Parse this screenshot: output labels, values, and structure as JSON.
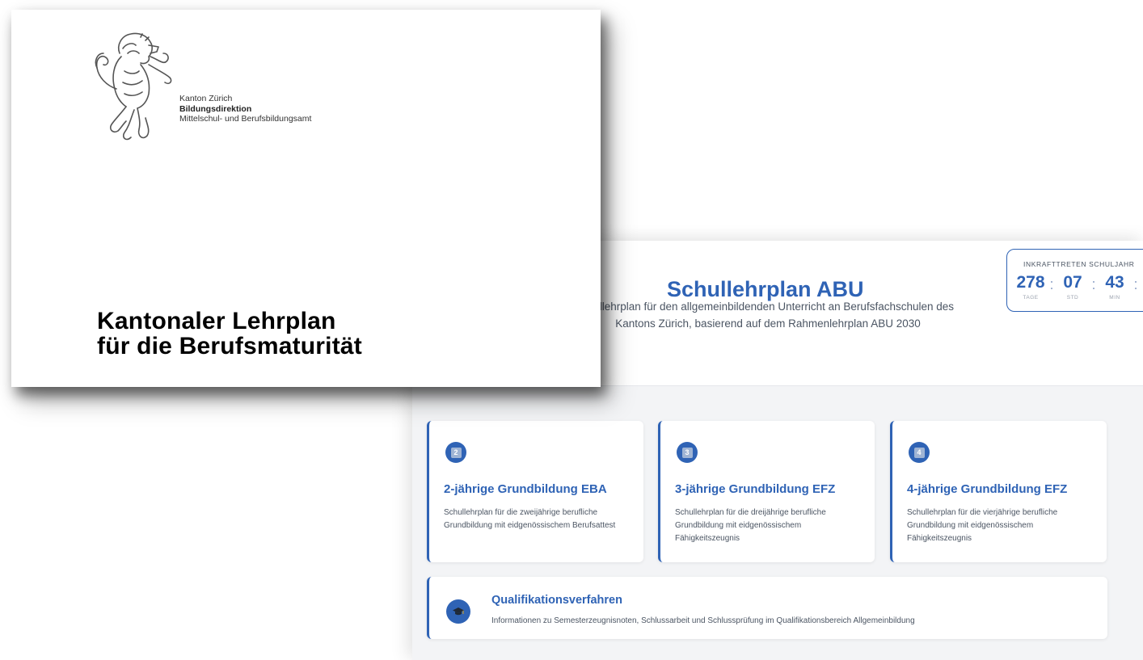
{
  "document": {
    "org_lines": [
      "Kanton Zürich",
      "Bildungsdirektion",
      "Mittelschul- und Berufsbildungsamt"
    ],
    "title_lines": [
      "Kantonaler Lehrplan",
      "für die Berufsmaturität"
    ],
    "logo": "zurich-lion-logo"
  },
  "webpage": {
    "title": "Schullehrplan ABU",
    "subtitle_lines": [
      "chullehrplan für den allgemeinbildenden Unterricht an Berufsfachschulen des",
      "Kantons Zürich, basierend auf dem Rahmenlehrplan ABU 2030"
    ],
    "countdown": {
      "label": "INKRAFTTRETEN SCHULJAHR",
      "units": [
        {
          "value": "278",
          "name": "TAGE"
        },
        {
          "value": "07",
          "name": "STD"
        },
        {
          "value": "43",
          "name": "MIN"
        }
      ],
      "separator": ":"
    },
    "cards": [
      {
        "badge": "2",
        "title": "2-jährige Grundbildung EBA",
        "desc": "Schullehrplan für die zweijährige berufliche Grundbildung mit eidgenössischem Berufsattest"
      },
      {
        "badge": "3",
        "title": "3-jährige Grundbildung EFZ",
        "desc": "Schullehrplan für die dreijährige berufliche Grundbildung mit eidgenössischem Fähigkeitszeugnis"
      },
      {
        "badge": "4",
        "title": "4-jährige Grundbildung EFZ",
        "desc": "Schullehrplan für die vierjährige berufliche Grundbildung mit eidgenössischem Fähigkeitszeugnis"
      }
    ],
    "qualification": {
      "icon": "graduation-cap-icon",
      "title": "Qualifikationsverfahren",
      "desc": "Informationen zu Semesterzeugnisnoten, Schlussarbeit und Schlussprüfung im Qualifikationsbereich Allgemeinbildung"
    },
    "colors": {
      "accent": "#2f63b5",
      "background": "#f3f4f6"
    }
  }
}
